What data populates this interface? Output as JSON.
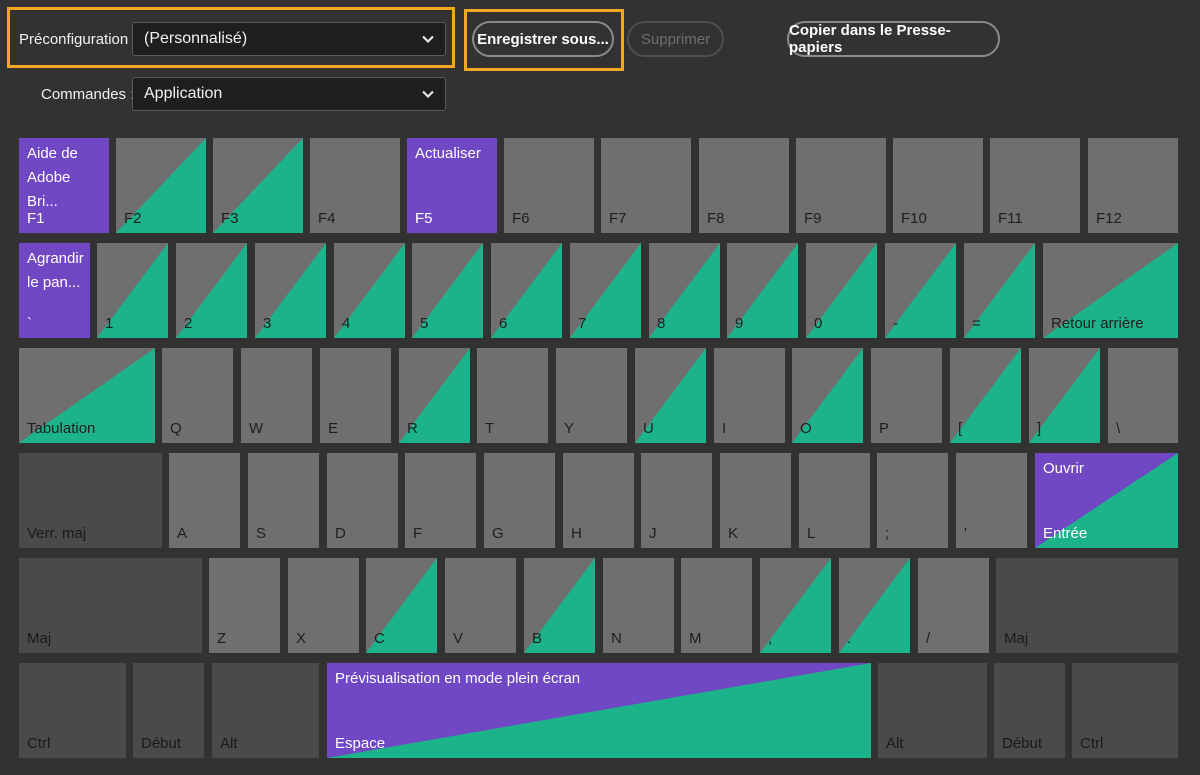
{
  "toolbar": {
    "preset_label": "Préconfiguration :",
    "preset_value": "(Personnalisé)",
    "commands_label": "Commandes :",
    "commands_value": "Application",
    "save_as": "Enregistrer sous...",
    "delete": "Supprimer",
    "copy_clipboard": "Copier dans le Presse-papiers"
  },
  "colors": {
    "assigned_purple": "#7048c4",
    "available_green": "#1db38a",
    "highlight_orange": "#f5a623"
  },
  "keyboard": {
    "row1": [
      {
        "cap": "F1",
        "cmd": "Aide de Adobe Bri..."
      },
      {
        "cap": "F2"
      },
      {
        "cap": "F3"
      },
      {
        "cap": "F4"
      },
      {
        "cap": "F5",
        "cmd": "Actualiser"
      },
      {
        "cap": "F6"
      },
      {
        "cap": "F7"
      },
      {
        "cap": "F8"
      },
      {
        "cap": "F9"
      },
      {
        "cap": "F10"
      },
      {
        "cap": "F11"
      },
      {
        "cap": "F12"
      }
    ],
    "row2": [
      {
        "cap": "`",
        "cmd": "Agrandir le pan..."
      },
      {
        "cap": "1"
      },
      {
        "cap": "2"
      },
      {
        "cap": "3"
      },
      {
        "cap": "4"
      },
      {
        "cap": "5"
      },
      {
        "cap": "6"
      },
      {
        "cap": "7"
      },
      {
        "cap": "8"
      },
      {
        "cap": "9"
      },
      {
        "cap": "0"
      },
      {
        "cap": "-"
      },
      {
        "cap": "="
      },
      {
        "cap": "Retour arrière"
      }
    ],
    "row3": [
      {
        "cap": "Tabulation"
      },
      {
        "cap": "Q"
      },
      {
        "cap": "W"
      },
      {
        "cap": "E"
      },
      {
        "cap": "R"
      },
      {
        "cap": "T"
      },
      {
        "cap": "Y"
      },
      {
        "cap": "U"
      },
      {
        "cap": "I"
      },
      {
        "cap": "O"
      },
      {
        "cap": "P"
      },
      {
        "cap": "["
      },
      {
        "cap": "]"
      },
      {
        "cap": "\\"
      }
    ],
    "row4": [
      {
        "cap": "Verr. maj"
      },
      {
        "cap": "A"
      },
      {
        "cap": "S"
      },
      {
        "cap": "D"
      },
      {
        "cap": "F"
      },
      {
        "cap": "G"
      },
      {
        "cap": "H"
      },
      {
        "cap": "J"
      },
      {
        "cap": "K"
      },
      {
        "cap": "L"
      },
      {
        "cap": ";"
      },
      {
        "cap": "'"
      },
      {
        "cap": "Entrée",
        "cmd": "Ouvrir"
      }
    ],
    "row5": [
      {
        "cap": "Maj"
      },
      {
        "cap": "Z"
      },
      {
        "cap": "X"
      },
      {
        "cap": "C"
      },
      {
        "cap": "V"
      },
      {
        "cap": "B"
      },
      {
        "cap": "N"
      },
      {
        "cap": "M"
      },
      {
        "cap": ","
      },
      {
        "cap": "."
      },
      {
        "cap": "/"
      },
      {
        "cap": "Maj"
      }
    ],
    "row6": [
      {
        "cap": "Ctrl"
      },
      {
        "cap": "Début"
      },
      {
        "cap": "Alt"
      },
      {
        "cap": "Espace",
        "cmd": "Prévisualisation en mode plein écran"
      },
      {
        "cap": "Alt"
      },
      {
        "cap": "Début"
      },
      {
        "cap": "Ctrl"
      }
    ]
  }
}
